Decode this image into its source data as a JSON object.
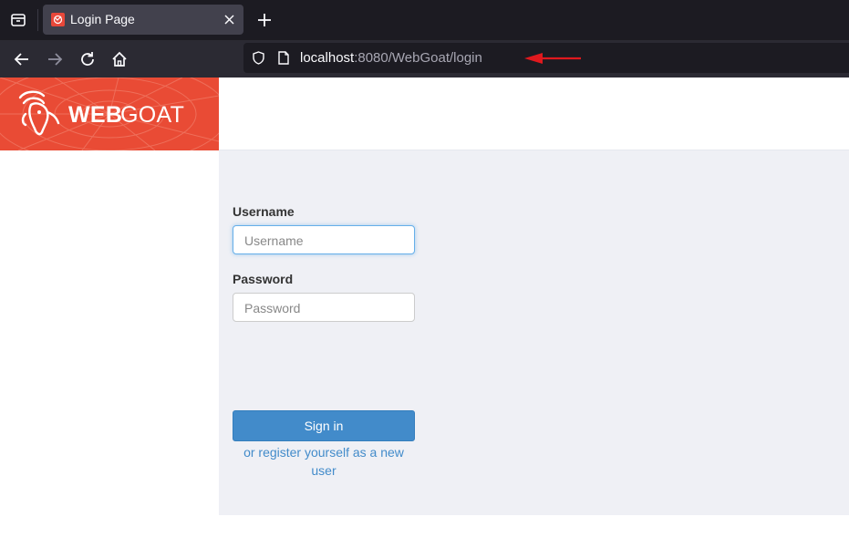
{
  "browser": {
    "tab": {
      "title": "Login Page"
    },
    "url": {
      "host": "localhost",
      "rest": ":8080/WebGoat/login"
    }
  },
  "header": {
    "logo_part1": "WEB",
    "logo_part2": "GOAT"
  },
  "login_form": {
    "username_label": "Username",
    "username_placeholder": "Username",
    "password_label": "Password",
    "password_placeholder": "Password",
    "signin_label": "Sign in",
    "register_text": "or register yourself as a new user"
  },
  "colors": {
    "brand": "#e94b35",
    "primary_button": "#428bca",
    "annotation_arrow": "#e0191e"
  }
}
